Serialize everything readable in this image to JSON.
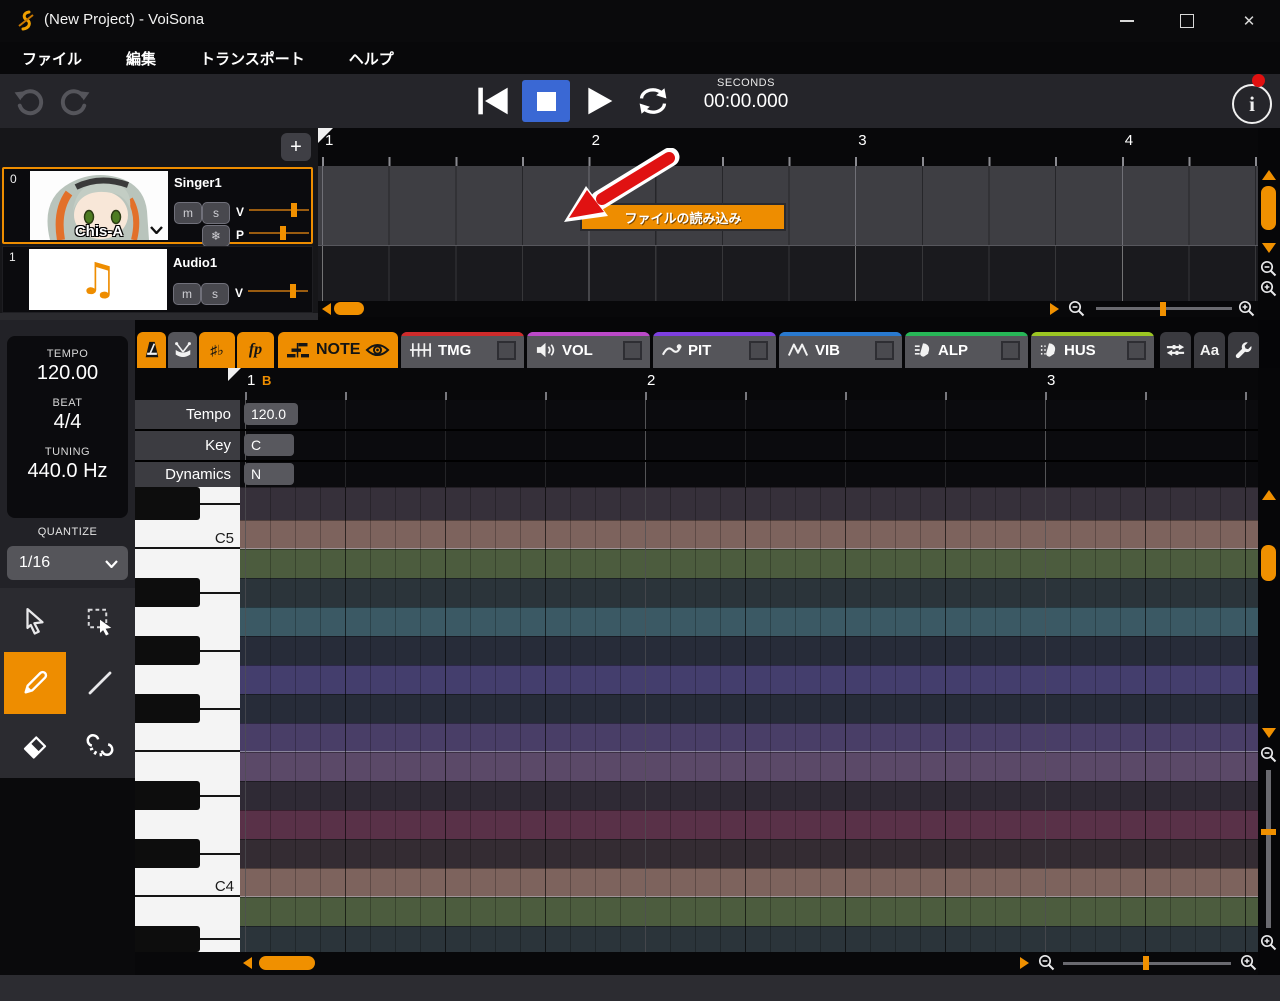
{
  "window": {
    "title": "(New Project) - VoiSona",
    "controls": {
      "close": "✕"
    }
  },
  "menu": {
    "items": [
      "ファイル",
      "編集",
      "トランスポート",
      "ヘルプ"
    ]
  },
  "transport": {
    "seconds_label": "SECONDS",
    "time": "00:00.000",
    "info_glyph": "i"
  },
  "track_panel": {
    "add_button": "+",
    "tracks": [
      {
        "index": "0",
        "name": "Singer1",
        "voice": "Chis-A",
        "mute": "m",
        "solo": "s",
        "volume_label": "V",
        "pan_label": "P",
        "freeze_glyph": "❄"
      },
      {
        "index": "1",
        "name": "Audio1",
        "mute": "m",
        "solo": "s",
        "volume_label": "V",
        "note_glyph": "♫"
      }
    ]
  },
  "timeline": {
    "measures": [
      "1",
      "2",
      "3",
      "4"
    ],
    "load_file_button": "ファイルの読み込み"
  },
  "sidebar": {
    "tempo_label": "TEMPO",
    "tempo_value": "120.00",
    "beat_label": "BEAT",
    "beat_value": "4/4",
    "tuning_label": "TUNING",
    "tuning_value": "440.0 Hz",
    "quantize_label": "QUANTIZE",
    "quantize_value": "1/16"
  },
  "editor": {
    "left_buttons": [
      {
        "icon": "metronome-icon",
        "active": true
      },
      {
        "icon": "drum-icon",
        "active": false
      },
      {
        "icon": "accidental-icon",
        "text": "♯♭",
        "active": true
      },
      {
        "icon": "dynamics-fp-icon",
        "text": "fp",
        "active": true
      }
    ],
    "tabs": [
      {
        "label": "NOTE",
        "icon": "note-icon",
        "selected": true,
        "eye": true,
        "color": "#ee8d00"
      },
      {
        "label": "TMG",
        "icon": "timing-icon",
        "stripe": "#cf2b2b"
      },
      {
        "label": "VOL",
        "icon": "volume-icon",
        "stripe": "#bb49c8"
      },
      {
        "label": "PIT",
        "icon": "pitch-icon",
        "stripe": "#7d3fe0"
      },
      {
        "label": "VIB",
        "icon": "vibrato-icon",
        "stripe": "#2979cf"
      },
      {
        "label": "ALP",
        "icon": "alp-icon",
        "stripe": "#27b757"
      },
      {
        "label": "HUS",
        "icon": "hus-icon",
        "stripe": "#9cc723"
      }
    ],
    "right_buttons": [
      {
        "icon": "mixer-icon"
      },
      {
        "icon": "font-icon",
        "text": "Aa"
      },
      {
        "icon": "wrench-icon"
      }
    ],
    "ruler": {
      "measures": [
        "1",
        "2",
        "3"
      ],
      "marker": "B"
    },
    "params": [
      {
        "label": "Tempo",
        "value": "120.0"
      },
      {
        "label": "Key",
        "value": "C"
      },
      {
        "label": "Dynamics",
        "value": "N"
      }
    ],
    "rows": [
      {
        "note": "C#5",
        "type": "black",
        "color": "#36303a"
      },
      {
        "note": "C5",
        "type": "white",
        "label": "C5",
        "color": "#7d635d",
        "separator": true
      },
      {
        "note": "B4",
        "type": "white",
        "color": "#4c5c3e"
      },
      {
        "note": "A#4",
        "type": "black",
        "color": "#2b343a"
      },
      {
        "note": "A4",
        "type": "white",
        "color": "#3b5964"
      },
      {
        "note": "G#4",
        "type": "black",
        "color": "#272c39"
      },
      {
        "note": "G4",
        "type": "white",
        "color": "#443e6d"
      },
      {
        "note": "F#4",
        "type": "black",
        "color": "#272c39"
      },
      {
        "note": "F4",
        "type": "white",
        "color": "#493e67",
        "separator": true
      },
      {
        "note": "E4",
        "type": "white",
        "color": "#5b4968"
      },
      {
        "note": "D#4",
        "type": "black",
        "color": "#2f2a35"
      },
      {
        "note": "D4",
        "type": "white",
        "color": "#593148"
      },
      {
        "note": "C#4",
        "type": "black",
        "color": "#342c33"
      },
      {
        "note": "C4",
        "type": "white",
        "label": "C4",
        "color": "#7d635d",
        "separator": true
      },
      {
        "note": "B3",
        "type": "white",
        "color": "#4c5c3e"
      },
      {
        "note": "A#3",
        "type": "black",
        "color": "#2b343a"
      }
    ]
  },
  "tools": [
    {
      "name": "pointer-tool"
    },
    {
      "name": "marquee-select-tool"
    },
    {
      "name": "pencil-tool",
      "selected": true
    },
    {
      "name": "line-tool"
    },
    {
      "name": "eraser-tool"
    },
    {
      "name": "unlink-tool"
    }
  ],
  "colors": {
    "accent": "#ee8d00",
    "stop_active": "#3a68d4",
    "notification": "#e01010"
  }
}
